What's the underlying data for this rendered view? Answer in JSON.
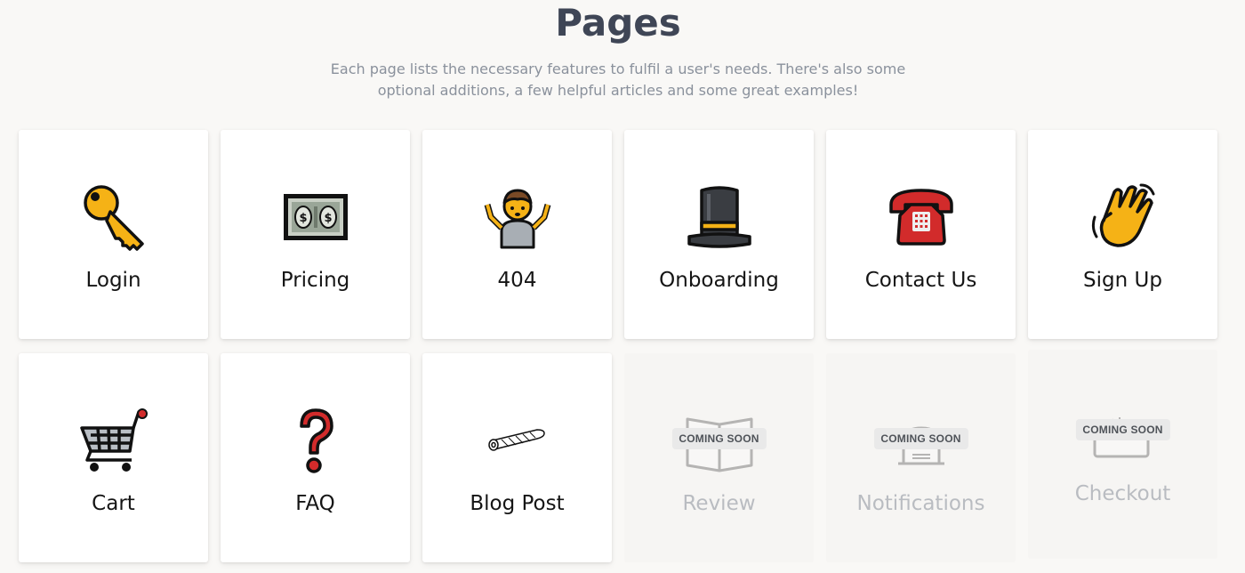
{
  "header": {
    "title": "Pages",
    "subtitle_line1": "Each page lists the necessary features to fulfil a user's needs. There's also some",
    "subtitle_line2": "optional additions, a few helpful articles and some great examples!"
  },
  "cards": [
    {
      "label": "Login",
      "icon": "key-icon",
      "coming_soon": false
    },
    {
      "label": "Pricing",
      "icon": "dollar-bill-icon",
      "coming_soon": false
    },
    {
      "label": "404",
      "icon": "person-shrugging-icon",
      "coming_soon": false
    },
    {
      "label": "Onboarding",
      "icon": "top-hat-icon",
      "coming_soon": false
    },
    {
      "label": "Contact Us",
      "icon": "telephone-icon",
      "coming_soon": false
    },
    {
      "label": "Sign Up",
      "icon": "waving-hand-icon",
      "coming_soon": false
    },
    {
      "label": "Cart",
      "icon": "shopping-cart-icon",
      "coming_soon": false
    },
    {
      "label": "FAQ",
      "icon": "question-mark-icon",
      "coming_soon": false
    },
    {
      "label": "Blog Post",
      "icon": "rolled-newspaper-icon",
      "coming_soon": false
    },
    {
      "label": "Review",
      "icon": "open-book-icon",
      "coming_soon": true,
      "badge": "COMING SOON"
    },
    {
      "label": "Notifications",
      "icon": "bell-icon",
      "coming_soon": true,
      "badge": "COMING SOON"
    },
    {
      "label": "Checkout",
      "icon": "credit-card-icon",
      "coming_soon": true,
      "badge": "COMING SOON"
    }
  ],
  "colors": {
    "background": "#f9f8f6",
    "title": "#3f4656",
    "subtitle": "#8a919c",
    "card": "#ffffff",
    "disabled_label": "#b9bcc1"
  }
}
